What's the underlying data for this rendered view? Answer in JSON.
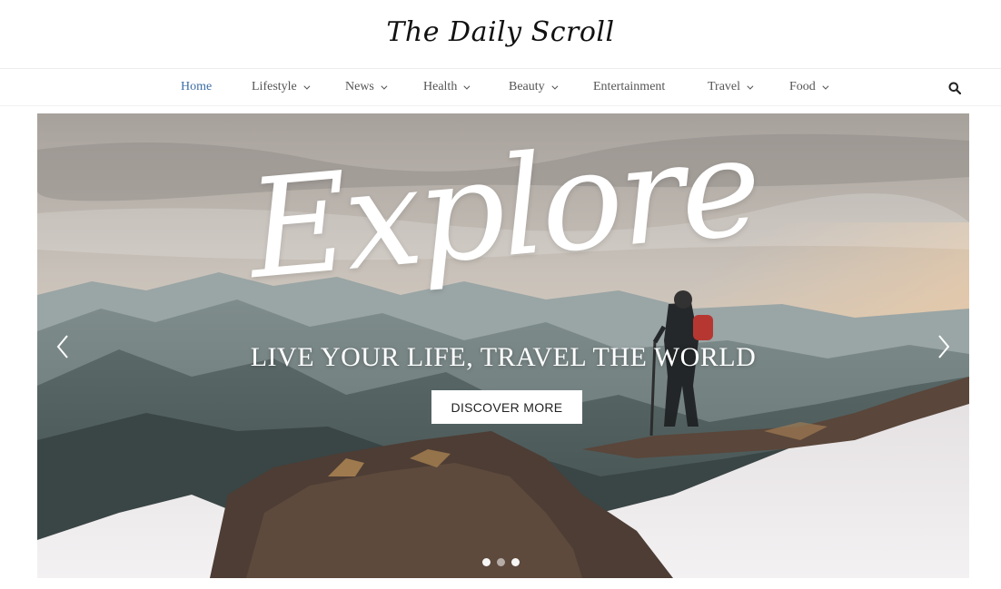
{
  "site": {
    "logo": "The Daily Scroll"
  },
  "nav": {
    "items": [
      {
        "label": "Home",
        "active": true,
        "dropdown": false
      },
      {
        "label": "Lifestyle",
        "active": false,
        "dropdown": true
      },
      {
        "label": "News",
        "active": false,
        "dropdown": true
      },
      {
        "label": "Health",
        "active": false,
        "dropdown": true
      },
      {
        "label": "Beauty",
        "active": false,
        "dropdown": true
      },
      {
        "label": "Entertainment",
        "active": false,
        "dropdown": false
      },
      {
        "label": "Travel",
        "active": false,
        "dropdown": true
      },
      {
        "label": "Food",
        "active": false,
        "dropdown": true
      }
    ],
    "search_icon": "search-icon"
  },
  "hero": {
    "title": "Explore",
    "subtitle": "LIVE YOUR LIFE, TRAVEL THE WORLD",
    "button": "DISCOVER MORE",
    "prev_icon": "chevron-left-icon",
    "next_icon": "chevron-right-icon",
    "slides": 3,
    "active_slide": 2
  },
  "colors": {
    "active_nav": "#3d6ea5",
    "text": "#555555",
    "hero_text": "#ffffff"
  }
}
